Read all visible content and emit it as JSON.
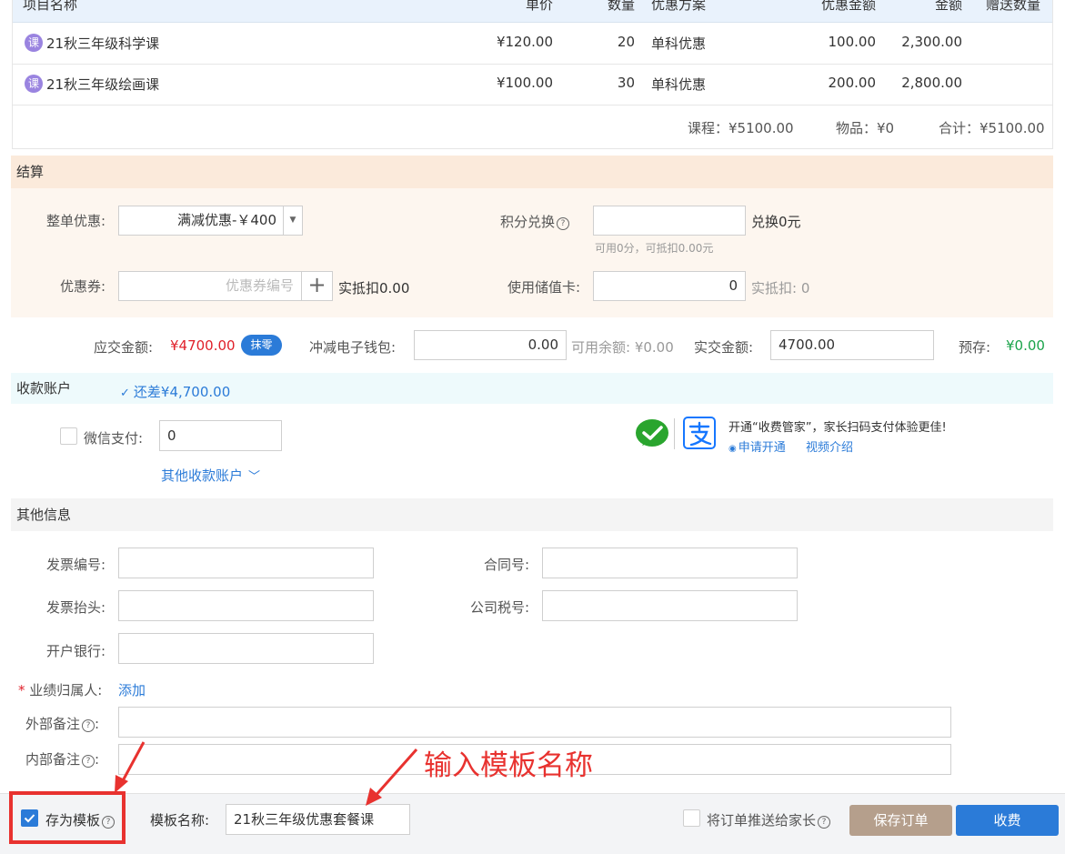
{
  "table": {
    "headers": [
      "项目名称",
      "单价",
      "数量",
      "优惠方案",
      "优惠金额",
      "金额",
      "赠送数量"
    ],
    "rows": [
      {
        "icon_text": "课",
        "name": "21秋三年级科学课",
        "price": "¥120.00",
        "qty": "20",
        "plan": "单科优惠",
        "discount": "100.00",
        "amount": "2,300.00",
        "gift": ""
      },
      {
        "icon_text": "课",
        "name": "21秋三年级绘画课",
        "price": "¥100.00",
        "qty": "30",
        "plan": "单科优惠",
        "discount": "200.00",
        "amount": "2,800.00",
        "gift": ""
      }
    ],
    "summary": {
      "course": "课程：¥5100.00",
      "goods": "物品：¥0",
      "total": "合计：¥5100.00"
    }
  },
  "settlement": {
    "title": "结算",
    "order_discount_label": "整单优惠:",
    "order_discount_value": "满减优惠-￥400",
    "points_label": "积分兑换",
    "points_value": "",
    "points_result": "兑换0元",
    "points_hint": "可用0分，可抵扣0.00元",
    "coupon_label": "优惠券:",
    "coupon_placeholder": "优惠券编号",
    "coupon_add": "+",
    "coupon_deduct": "实抵扣0.00",
    "stored_card_label": "使用储值卡:",
    "stored_card_value": "0",
    "stored_card_deduct": "实抵扣:  0"
  },
  "amounts": {
    "due_label": "应交金额:",
    "due_value": "¥4700.00",
    "round_btn": "抹零",
    "wallet_label": "冲减电子钱包:",
    "wallet_value": "0.00",
    "available_balance": "可用余额:  ¥0.00",
    "actual_label": "实交金额:",
    "actual_value": "4700.00",
    "prestore_label": "预存:",
    "prestore_value": "¥0.00"
  },
  "payment": {
    "title": "收款账户",
    "remaining": "还差¥4,700.00",
    "wechat_label": "微信支付:",
    "wechat_value": "0",
    "other_accounts": "其他收款账户",
    "promo_text": "开通“收费管家”，家长扫码支付体验更佳!",
    "apply_link": "申请开通",
    "video_link": "视频介绍"
  },
  "other_info": {
    "title": "其他信息",
    "invoice_no_label": "发票编号:",
    "contract_label": "合同号:",
    "invoice_title_label": "发票抬头:",
    "tax_no_label": "公司税号:",
    "bank_label": "开户银行:",
    "performance_required": "*",
    "performance_label": "业绩归属人:",
    "performance_add": "添加",
    "external_note_label": "外部备注",
    "internal_note_label": "内部备注",
    "colon": ":"
  },
  "annotation": {
    "text": "输入模板名称",
    "color": "#e8322f"
  },
  "footer": {
    "save_template_label": "存为模板",
    "template_name_label": "模板名称:",
    "template_name_value": "21秋三年级优惠套餐课",
    "push_to_parent": "将订单推送给家长",
    "save_order": "保存订单",
    "charge": "收费"
  },
  "colors": {
    "primary": "#2b7bd8",
    "save_order_bg": "#b59f8c",
    "settlement_bg": "#fdf6ef",
    "payment_bg": "#eefafc"
  }
}
